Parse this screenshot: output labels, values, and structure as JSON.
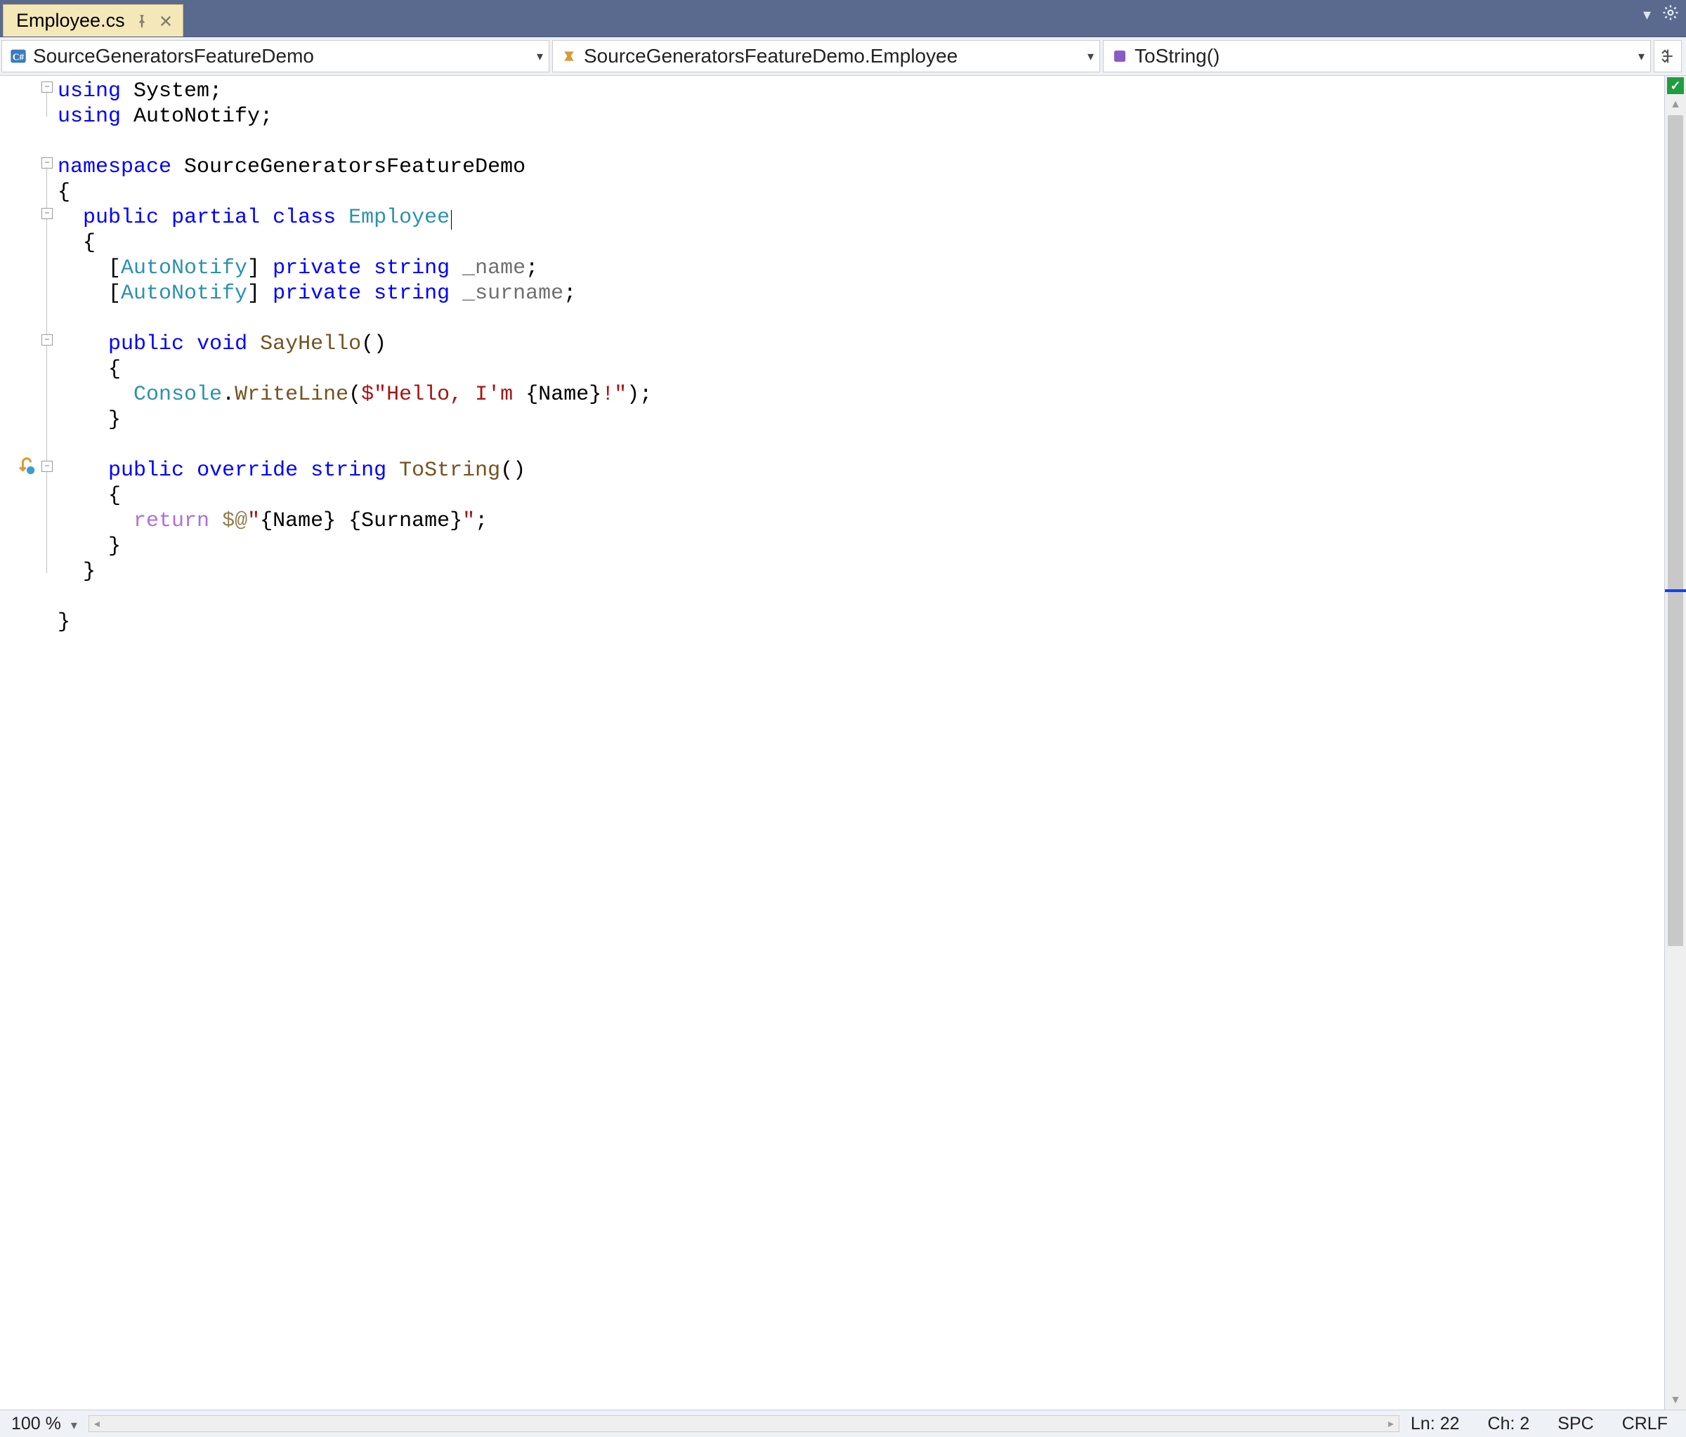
{
  "tab": {
    "filename": "Employee.cs"
  },
  "nav": {
    "project": "SourceGeneratorsFeatureDemo",
    "type": "SourceGeneratorsFeatureDemo.Employee",
    "member": "ToString()"
  },
  "code": {
    "using1_kw": "using",
    "using1_ns": "System",
    "using2_kw": "using",
    "using2_ns": "AutoNotify",
    "ns_kw": "namespace",
    "ns_name": "SourceGeneratorsFeatureDemo",
    "cls_pub": "public",
    "cls_part": "partial",
    "cls_cls": "class",
    "cls_name": "Employee",
    "attr_name": "AutoNotify",
    "f_priv": "private",
    "f_str": "string",
    "f1_name": "_name",
    "f2_name": "_surname",
    "m1_pub": "public",
    "m1_void": "void",
    "m1_name": "SayHello",
    "cw_cls": "Console",
    "cw_mth": "WriteLine",
    "cw_str_a": "\"Hello, I'm ",
    "cw_prop": "Name",
    "cw_str_b": "!\"",
    "m2_pub": "public",
    "m2_ovr": "override",
    "m2_str": "string",
    "m2_name": "ToString",
    "ret_kw": "return",
    "ret_p1": "Name",
    "ret_p2": "Surname"
  },
  "status": {
    "zoom": "100 %",
    "ln": "Ln: 22",
    "ch": "Ch: 2",
    "ws": "SPC",
    "eol": "CRLF"
  },
  "colors": {
    "keyword": "#0000ff",
    "type": "#2b91af",
    "string": "#a31515",
    "method": "#74531f",
    "return": "#af6fe0",
    "tab_bg": "#f5e8b8",
    "titlebar": "#5a6a8f"
  }
}
